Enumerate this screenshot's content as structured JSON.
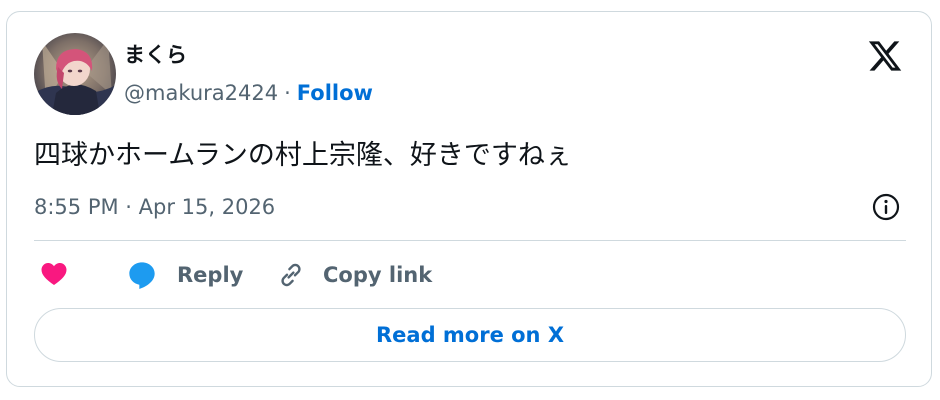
{
  "author": {
    "display_name": "まくら",
    "handle": "@makura2424",
    "separator": "·",
    "follow_label": "Follow"
  },
  "tweet": {
    "text": "四球かホームランの村上宗隆、好きですねぇ",
    "timestamp": "8:55 PM · Apr 15, 2026"
  },
  "actions": {
    "reply_label": "Reply",
    "copy_link_label": "Copy link"
  },
  "read_more_label": "Read more on X",
  "icons": {
    "brand": "x-logo-icon",
    "info": "info-icon",
    "like": "heart-icon",
    "reply": "speech-bubble-icon",
    "copy": "link-icon"
  },
  "colors": {
    "link_blue": "#006fd6",
    "heart_pink": "#f91880",
    "reply_blue": "#1d9bf0",
    "text_dark": "#0f1419",
    "text_gray": "#536471",
    "border": "#cfd9de"
  }
}
